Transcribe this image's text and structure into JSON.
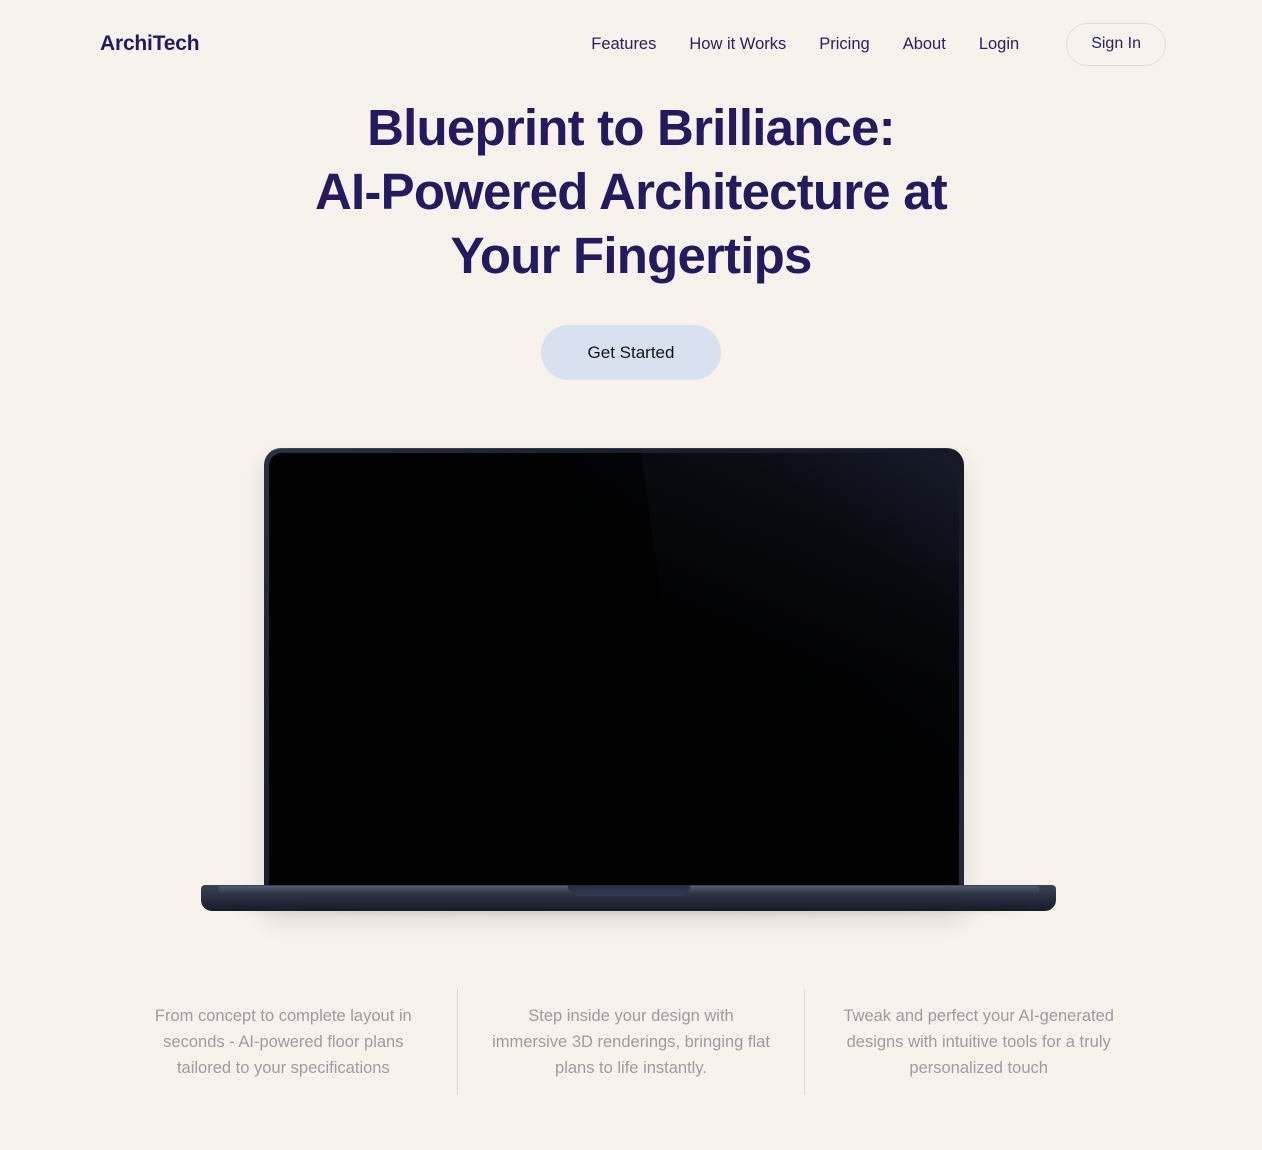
{
  "theme": {
    "background": "#f7f2ec",
    "primary_text": "#241a5e",
    "muted_text": "#a09aa3",
    "cta_background": "#d9e0f0",
    "divider": "#ded8d1",
    "border": "#e2ddd6"
  },
  "header": {
    "brand": "ArchiTech",
    "nav_items": [
      {
        "label": "Features"
      },
      {
        "label": "How it Works"
      },
      {
        "label": "Pricing"
      },
      {
        "label": "About"
      },
      {
        "label": "Login"
      }
    ],
    "sign_in_label": "Sign In"
  },
  "hero": {
    "title_line_1": "Blueprint to Brilliance:",
    "title_line_2": "AI-Powered Architecture at",
    "title_line_3": "Your Fingertips",
    "cta_label": "Get Started"
  },
  "mockup": {
    "device_label": "MacBook Pro",
    "screen_state": "blank"
  },
  "features": [
    {
      "text": "From concept to complete layout in seconds - AI-powered floor plans tailored to your specifications"
    },
    {
      "text": "Step inside your design with immersive 3D renderings, bringing flat plans to life instantly."
    },
    {
      "text": "Tweak and perfect your AI-generated designs with intuitive tools for a truly personalized touch"
    }
  ]
}
